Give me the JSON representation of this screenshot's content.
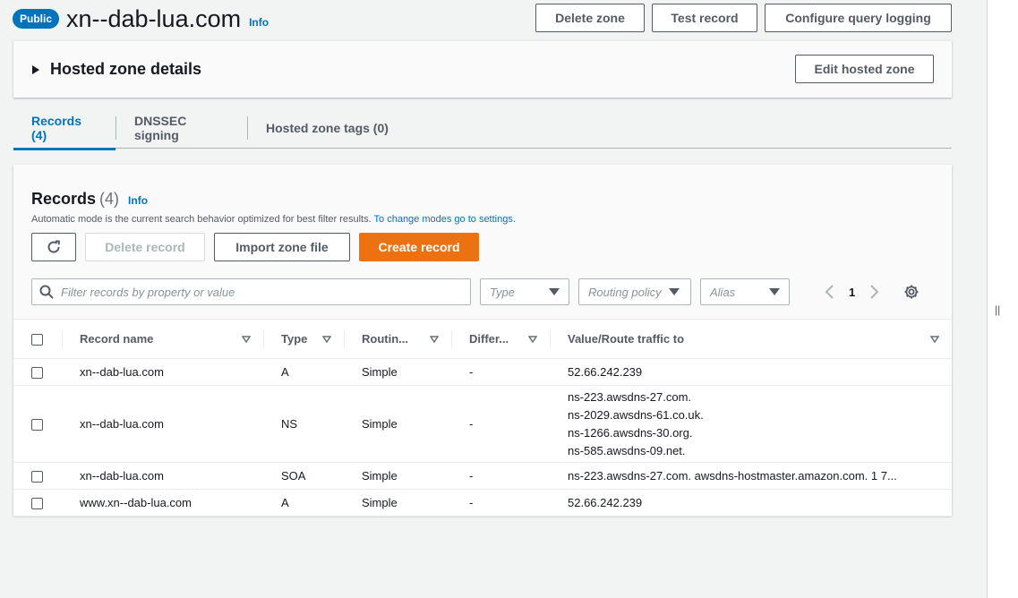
{
  "header": {
    "badge": "Public",
    "title": "xn--dab-lua.com",
    "info": "Info",
    "actions": {
      "delete_zone": "Delete zone",
      "test_record": "Test record",
      "configure_logging": "Configure query logging"
    }
  },
  "details": {
    "title": "Hosted zone details",
    "edit_button": "Edit hosted zone"
  },
  "tabs": [
    {
      "label": "Records (4)",
      "active": true
    },
    {
      "label": "DNSSEC signing",
      "active": false
    },
    {
      "label": "Hosted zone tags (0)",
      "active": false
    }
  ],
  "records": {
    "title": "Records",
    "count": "(4)",
    "info": "Info",
    "description": "Automatic mode is the current search behavior optimized for best filter results.",
    "description_link": "To change modes go to settings.",
    "buttons": {
      "delete": "Delete record",
      "import": "Import zone file",
      "create": "Create record"
    },
    "search_placeholder": "Filter records by property or value",
    "filters": {
      "type": "Type",
      "routing": "Routing policy",
      "alias": "Alias"
    },
    "page": "1",
    "columns": {
      "name": "Record name",
      "type": "Type",
      "routing": "Routin...",
      "differ": "Differ...",
      "value": "Value/Route traffic to"
    },
    "rows": [
      {
        "name": "xn--dab-lua.com",
        "type": "A",
        "routing": "Simple",
        "differ": "-",
        "values": [
          "52.66.242.239"
        ]
      },
      {
        "name": "xn--dab-lua.com",
        "type": "NS",
        "routing": "Simple",
        "differ": "-",
        "values": [
          "ns-223.awsdns-27.com.",
          "ns-2029.awsdns-61.co.uk.",
          "ns-1266.awsdns-30.org.",
          "ns-585.awsdns-09.net."
        ]
      },
      {
        "name": "xn--dab-lua.com",
        "type": "SOA",
        "routing": "Simple",
        "differ": "-",
        "values": [
          "ns-223.awsdns-27.com. awsdns-hostmaster.amazon.com. 1 7..."
        ]
      },
      {
        "name": "www.xn--dab-lua.com",
        "type": "A",
        "routing": "Simple",
        "differ": "-",
        "values": [
          "52.66.242.239"
        ]
      }
    ]
  },
  "colors": {
    "accent": "#0073bb",
    "primary_button": "#ec7211"
  }
}
